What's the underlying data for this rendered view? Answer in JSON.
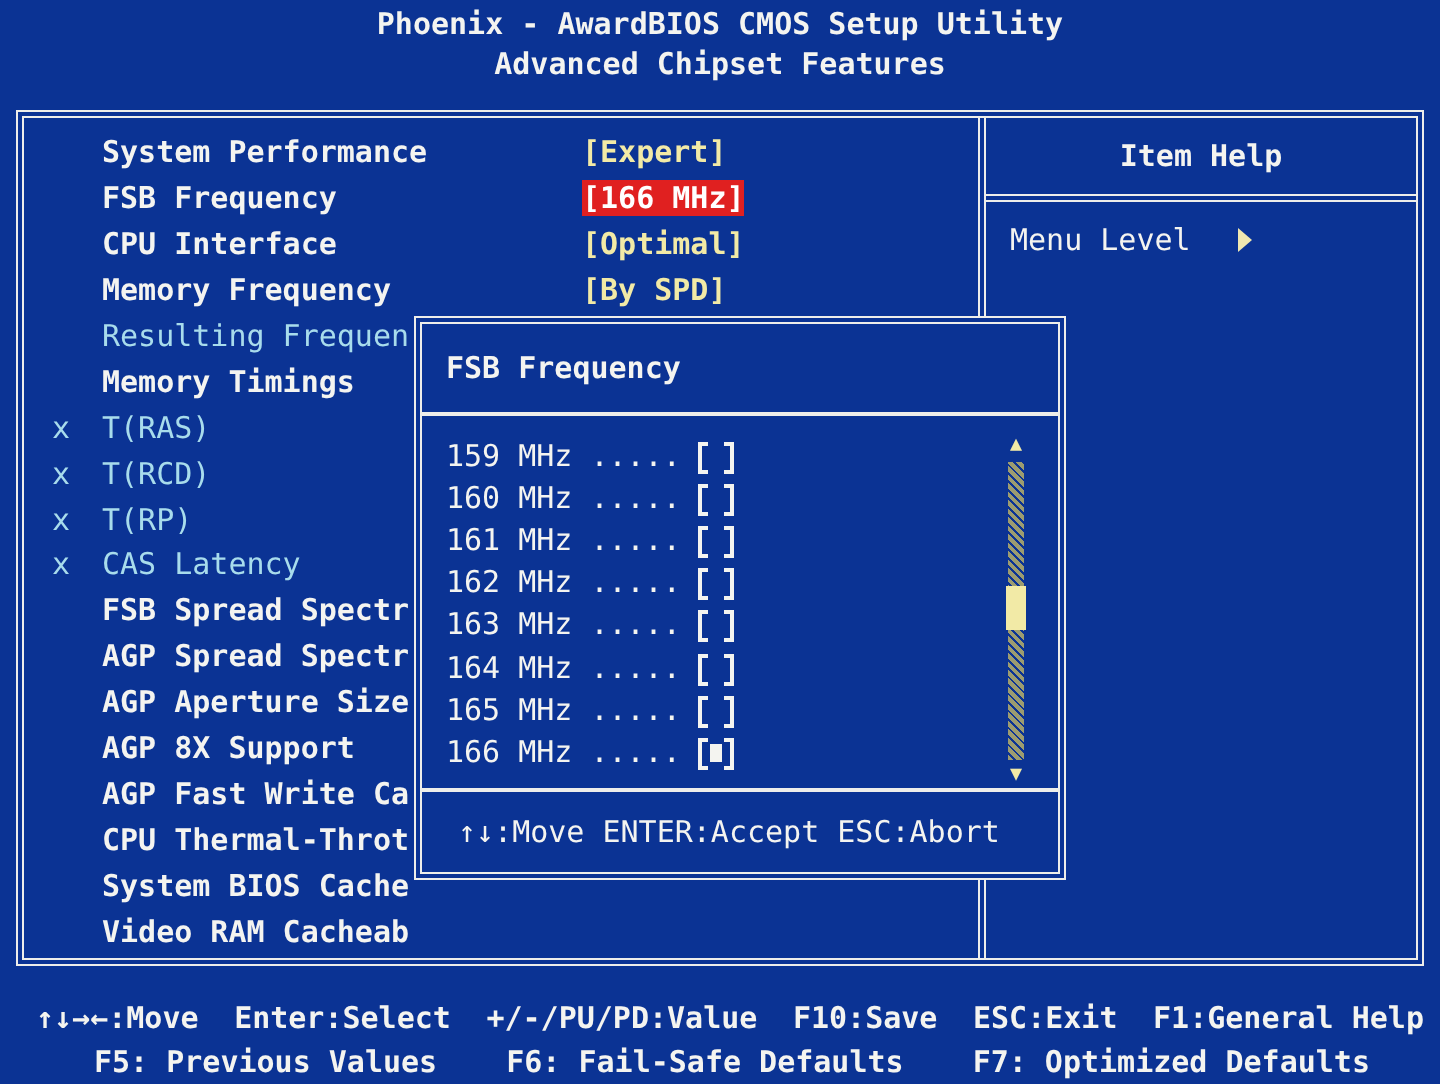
{
  "window": {
    "title": "Phoenix - AwardBIOS CMOS Setup Utility",
    "subtitle": "Advanced Chipset Features"
  },
  "settings": [
    {
      "label": "System Performance",
      "value": "[Expert]",
      "kind": "setting",
      "disabled": false,
      "selected": false
    },
    {
      "label": "FSB Frequency",
      "value": "[166 MHz]",
      "kind": "setting",
      "disabled": false,
      "selected": true
    },
    {
      "label": "CPU Interface",
      "value": "[Optimal]",
      "kind": "setting",
      "disabled": false,
      "selected": false
    },
    {
      "label": "Memory Frequency",
      "value": "[By SPD]",
      "kind": "setting",
      "disabled": false,
      "selected": false
    },
    {
      "label": "Resulting Frequen",
      "kind": "info"
    },
    {
      "label": "Memory Timings",
      "kind": "setting",
      "disabled": false
    },
    {
      "label": "T(RAS)",
      "kind": "setting",
      "disabled": true,
      "marker": "x"
    },
    {
      "label": "T(RCD)",
      "kind": "setting",
      "disabled": true,
      "marker": "x"
    },
    {
      "label": "T(RP)",
      "kind": "setting",
      "disabled": true,
      "marker": "x"
    },
    {
      "label": "CAS Latency",
      "kind": "setting",
      "disabled": true,
      "marker": "x"
    },
    {
      "label": "FSB Spread Spectr",
      "kind": "setting",
      "disabled": false
    },
    {
      "label": "AGP Spread Spectr",
      "kind": "setting",
      "disabled": false
    },
    {
      "label": "AGP Aperture Size",
      "kind": "setting",
      "disabled": false
    },
    {
      "label": "AGP 8X Support",
      "kind": "setting",
      "disabled": false
    },
    {
      "label": "AGP Fast Write Ca",
      "kind": "setting",
      "disabled": false
    },
    {
      "label": "CPU Thermal-Throt",
      "kind": "setting",
      "disabled": false
    },
    {
      "label": "System BIOS Cache",
      "kind": "setting",
      "disabled": false
    },
    {
      "label": "Video RAM Cacheab",
      "kind": "setting",
      "disabled": false
    }
  ],
  "item_help": {
    "title": "Item Help",
    "menu_level": "Menu Level"
  },
  "popup": {
    "title": "FSB Frequency",
    "scroll_up": "▲",
    "scroll_down": "▼",
    "hint": "↑↓:Move ENTER:Accept ESC:Abort",
    "options": [
      {
        "label": "159 MHz",
        "leader": ".....",
        "checked": false
      },
      {
        "label": "160 MHz",
        "leader": ".....",
        "checked": false
      },
      {
        "label": "161 MHz",
        "leader": ".....",
        "checked": false
      },
      {
        "label": "162 MHz",
        "leader": ".....",
        "checked": false
      },
      {
        "label": "163 MHz",
        "leader": ".....",
        "checked": false
      },
      {
        "label": "164 MHz",
        "leader": ".....",
        "checked": false
      },
      {
        "label": "165 MHz",
        "leader": ".....",
        "checked": false
      },
      {
        "label": "166 MHz",
        "leader": ".....",
        "checked": true
      }
    ]
  },
  "footer": [
    [
      "↑↓→←:Move",
      "Enter:Select",
      "+/-/PU/PD:Value",
      "F10:Save",
      "ESC:Exit",
      "F1:General Help"
    ],
    [
      "F5: Previous Values",
      "F6: Fail-Safe Defaults",
      "F7: Optimized Defaults"
    ]
  ]
}
